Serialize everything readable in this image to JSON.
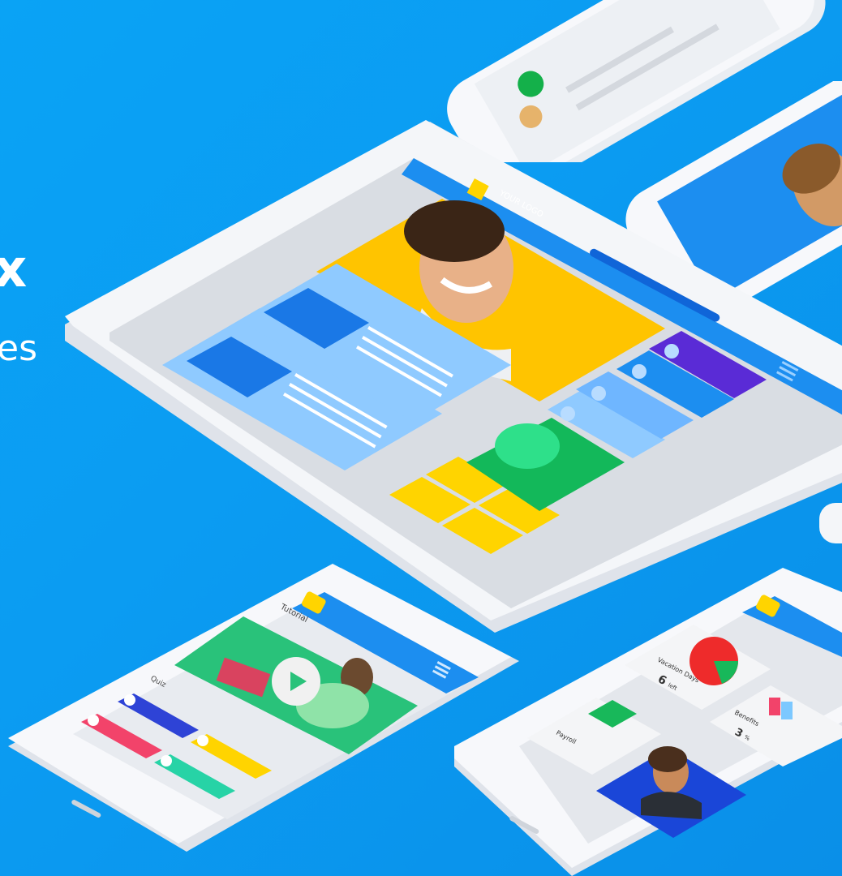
{
  "hero": {
    "line1": "x",
    "line2": "es"
  },
  "tablet": {
    "logo_text": "YOUR LOGO"
  },
  "phone_left": {
    "title": "Tutorial",
    "section": "Quiz"
  },
  "phone_right": {
    "vacation_label": "Vacation Days",
    "vacation_value": "6",
    "vacation_unit": "left",
    "benefits_label": "Benefits",
    "benefits_value": "3",
    "benefits_unit": "%",
    "payroll_label": "Payroll"
  },
  "colors": {
    "background": "#0aa3f5",
    "device_body": "#f4f6f9",
    "accent_blue": "#1d8ff0",
    "yellow": "#ffc400",
    "green": "#13b85a",
    "purple": "#5a2bd6"
  }
}
